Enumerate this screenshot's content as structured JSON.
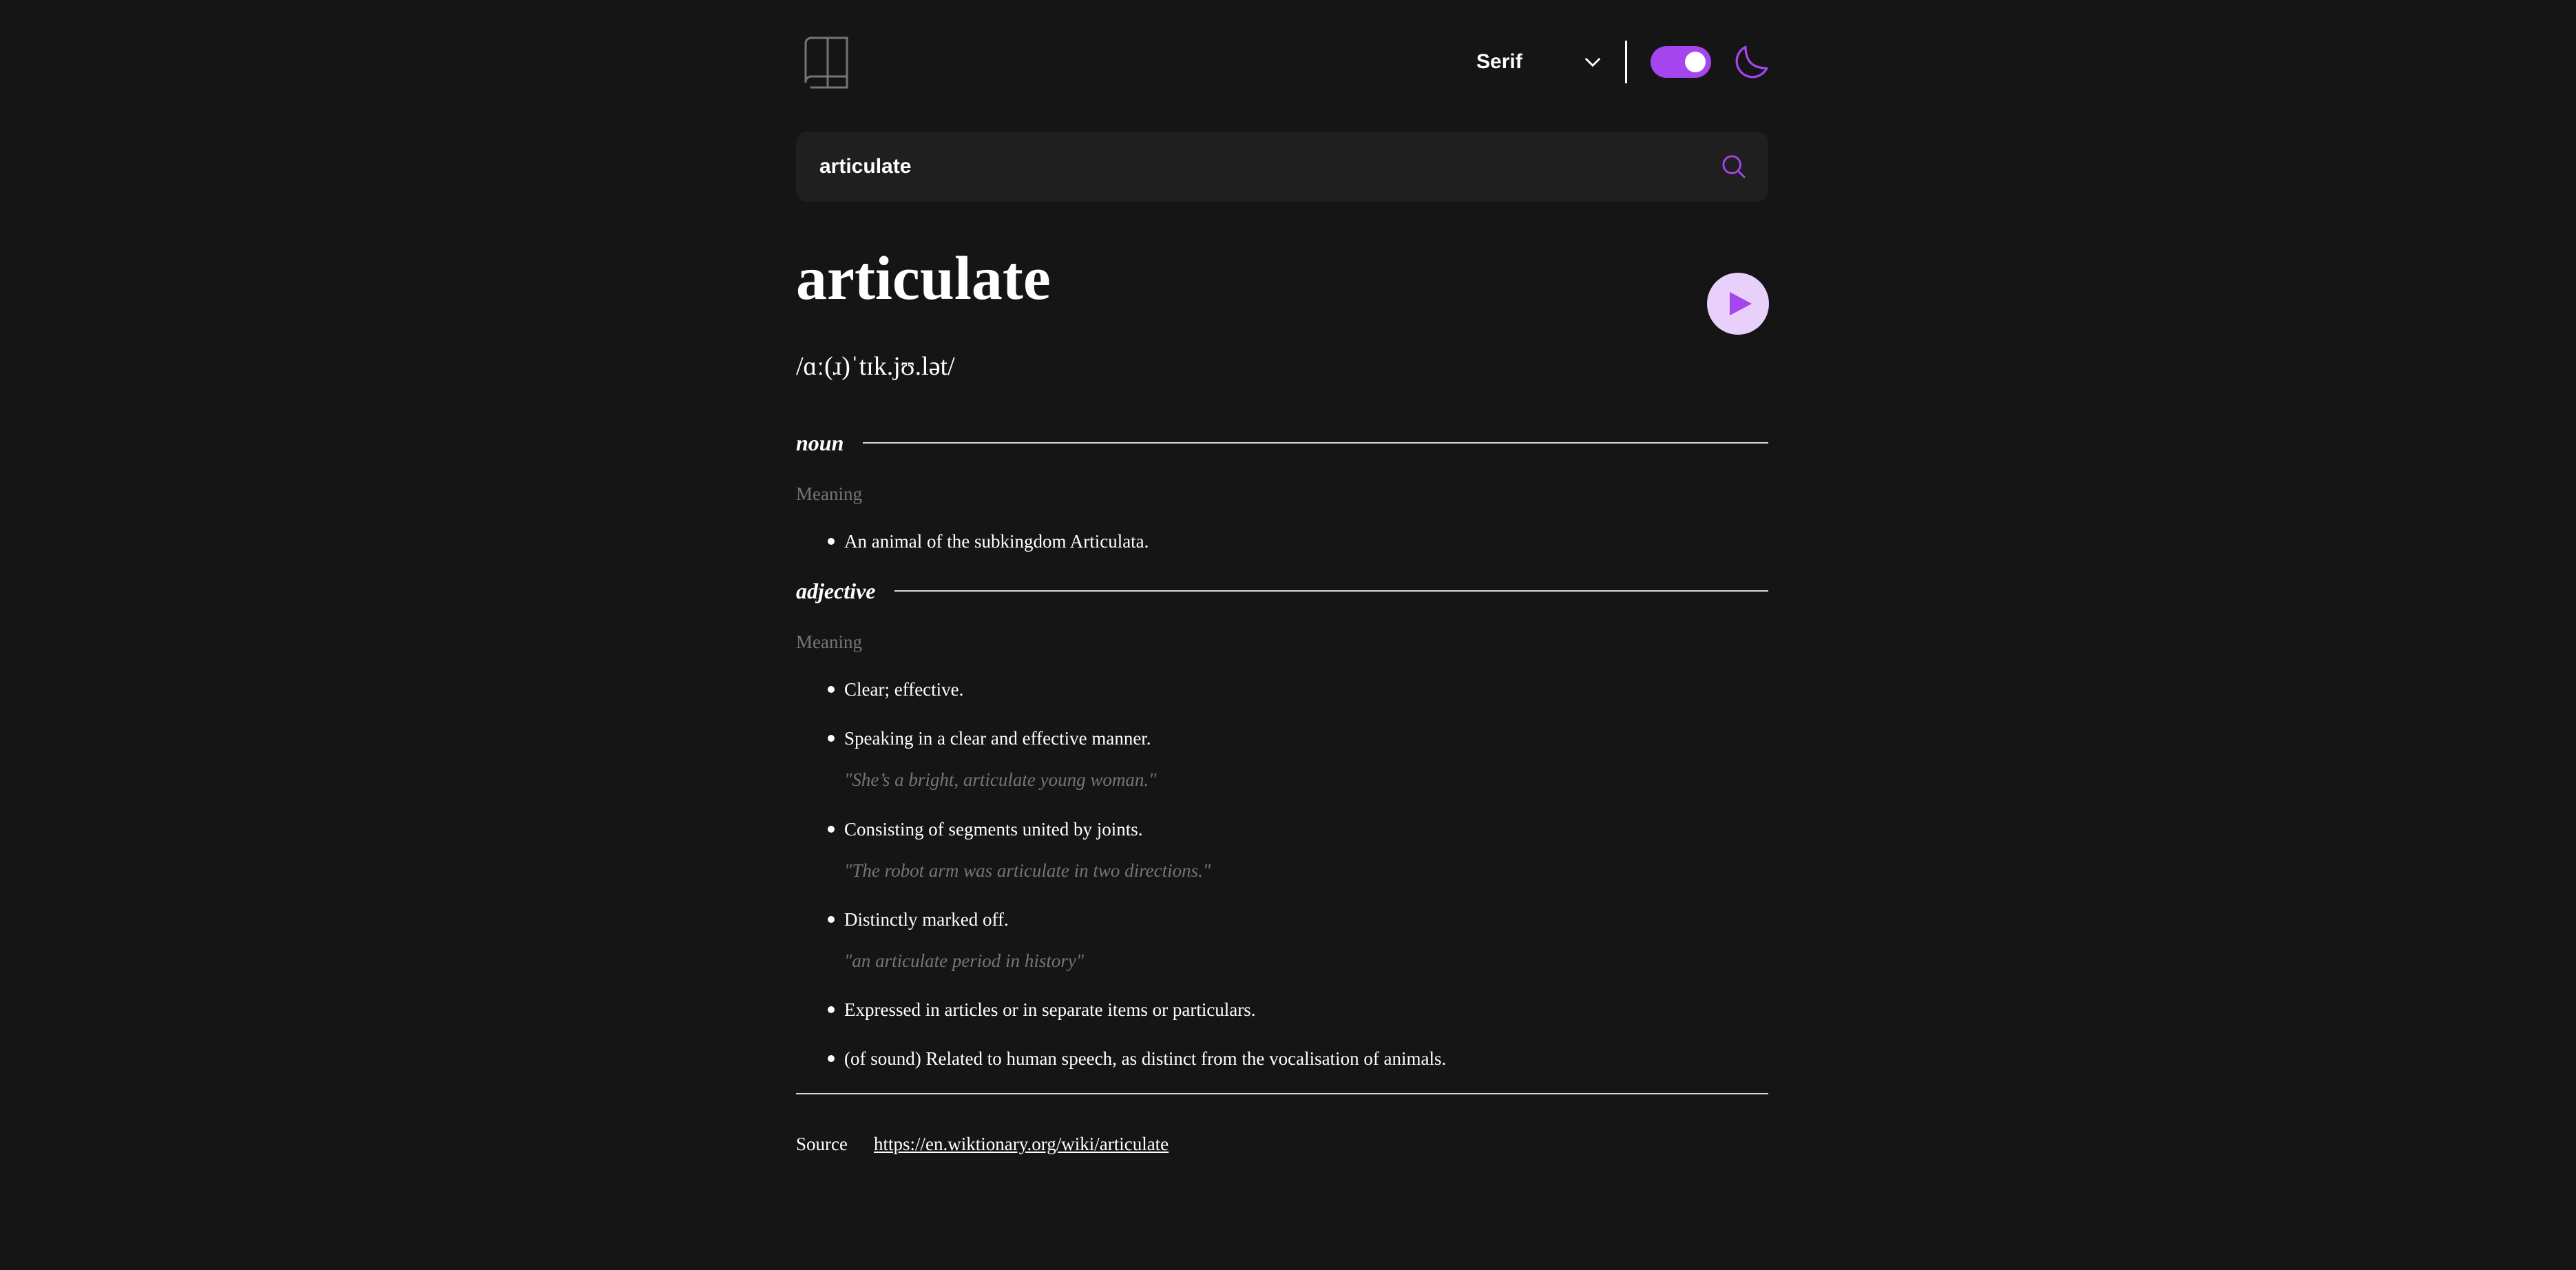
{
  "header": {
    "logo_icon": "book-icon",
    "font_selector": {
      "selected": "Serif",
      "icon": "chevron-down-icon"
    },
    "theme_toggle": {
      "state": "dark"
    },
    "theme_icon": "moon-icon"
  },
  "search": {
    "value": "articulate",
    "icon": "search-icon"
  },
  "word": {
    "title": "articulate",
    "phonetic": "/ɑː(ɹ)ˈtɪk.jʊ.lət/",
    "play_icon": "play-icon"
  },
  "meanings": [
    {
      "part_of_speech": "noun",
      "meaning_label": "Meaning",
      "definitions": [
        {
          "text": "An animal of the subkingdom Articulata."
        }
      ]
    },
    {
      "part_of_speech": "adjective",
      "meaning_label": "Meaning",
      "definitions": [
        {
          "text": "Clear; effective."
        },
        {
          "text": "Speaking in a clear and effective manner.",
          "example": "\"She’s a bright, articulate young woman.\""
        },
        {
          "text": "Consisting of segments united by joints.",
          "example": "\"The robot arm was articulate in two directions.\""
        },
        {
          "text": "Distinctly marked off.",
          "example": "\"an articulate period in history\""
        },
        {
          "text": "Expressed in articles or in separate items or particulars."
        },
        {
          "text": "(of sound) Related to human speech, as distinct from the vocalisation of animals."
        }
      ]
    }
  ],
  "source": {
    "label": "Source",
    "url": "https://en.wiktionary.org/wiki/articulate"
  },
  "colors": {
    "background": "#151515",
    "accent": "#a445ed",
    "play_bg": "#e9d0fa",
    "muted": "#757575",
    "search_bg": "#1f1f1f"
  }
}
